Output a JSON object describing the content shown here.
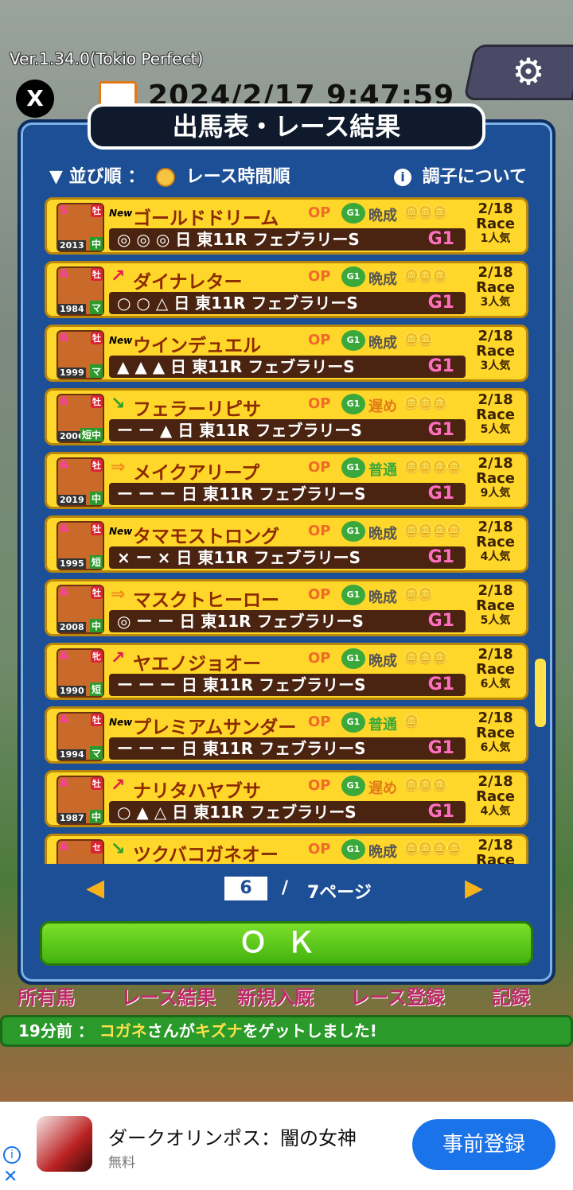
{
  "app": {
    "version": "Ver.1.34.0(Tokio Perfect)",
    "datetime": "2024/2/17 9:47:59",
    "x_label": "X"
  },
  "modal": {
    "title": "出馬表・レース結果",
    "sort_label": "▼ 並び順 ：",
    "sort_value": "レース時間順",
    "condition_label": "調子について",
    "info_glyph": "i"
  },
  "horses": [
    {
      "rank": "S",
      "sex": "牡",
      "year": "2013",
      "dist": "中",
      "badge": "New",
      "arrow": "",
      "arrow_color": "",
      "name": "ゴールドドリーム",
      "class": "OP",
      "growth": "晩成",
      "growth_type": "late-bloom",
      "coins": "🪙🪙🪙",
      "marks": "◎ ◎ ◎",
      "day": "日",
      "race": "東11R",
      "race_name": "フェブラリーS",
      "grade": "G1",
      "date": "2/18",
      "race_label": "Race",
      "popularity": "1人気"
    },
    {
      "rank": "A",
      "sex": "牡",
      "year": "1984",
      "dist": "マ",
      "badge": "",
      "arrow": "↗",
      "arrow_color": "#e0204a",
      "name": "ダイナレター",
      "class": "OP",
      "growth": "晩成",
      "growth_type": "late-bloom",
      "coins": "🪙🪙🪙",
      "marks": "○ ○ △",
      "day": "日",
      "race": "東11R",
      "race_name": "フェブラリーS",
      "grade": "G1",
      "date": "2/18",
      "race_label": "Race",
      "popularity": "3人気"
    },
    {
      "rank": "A",
      "sex": "牡",
      "year": "1999",
      "dist": "マ",
      "badge": "New",
      "arrow": "",
      "arrow_color": "",
      "name": "ウインデュエル",
      "class": "OP",
      "growth": "晩成",
      "growth_type": "late-bloom",
      "coins": "🪙🪙",
      "marks": "▲ ▲ ▲",
      "day": "日",
      "race": "東11R",
      "race_name": "フェブラリーS",
      "grade": "G1",
      "date": "2/18",
      "race_label": "Race",
      "popularity": "3人気"
    },
    {
      "rank": "A",
      "sex": "牡",
      "year": "2006",
      "dist": "短中",
      "badge": "",
      "arrow": "↘",
      "arrow_color": "#2aa02a",
      "name": "フェラーリピサ",
      "class": "OP",
      "growth": "遅め",
      "growth_type": "late",
      "coins": "🪙🪙🪙",
      "marks": "ー ー ▲",
      "day": "日",
      "race": "東11R",
      "race_name": "フェブラリーS",
      "grade": "G1",
      "date": "2/18",
      "race_label": "Race",
      "popularity": "5人気"
    },
    {
      "rank": "A",
      "sex": "牡",
      "year": "2019",
      "dist": "中",
      "badge": "",
      "arrow": "⇒",
      "arrow_color": "#f08a1a",
      "name": "メイクアリープ",
      "class": "OP",
      "growth": "普通",
      "growth_type": "normal",
      "coins": "🪙🪙🪙🪙",
      "marks": "ー ー ー",
      "day": "日",
      "race": "東11R",
      "race_name": "フェブラリーS",
      "grade": "G1",
      "date": "2/18",
      "race_label": "Race",
      "popularity": "9人気"
    },
    {
      "rank": "A",
      "sex": "牡",
      "year": "1995",
      "dist": "短",
      "badge": "New",
      "arrow": "",
      "arrow_color": "",
      "name": "タマモストロング",
      "class": "OP",
      "growth": "晩成",
      "growth_type": "late-bloom",
      "coins": "🪙🪙🪙🪙",
      "marks": "× ー ×",
      "day": "日",
      "race": "東11R",
      "race_name": "フェブラリーS",
      "grade": "G1",
      "date": "2/18",
      "race_label": "Race",
      "popularity": "4人気"
    },
    {
      "rank": "A",
      "sex": "牡",
      "year": "2008",
      "dist": "中",
      "badge": "",
      "arrow": "⇒",
      "arrow_color": "#f08a1a",
      "name": "マスクトヒーロー",
      "class": "OP",
      "growth": "晩成",
      "growth_type": "late-bloom",
      "coins": "🪙🪙",
      "marks": "◎ ー ー",
      "day": "日",
      "race": "東11R",
      "race_name": "フェブラリーS",
      "grade": "G1",
      "date": "2/18",
      "race_label": "Race",
      "popularity": "5人気"
    },
    {
      "rank": "A",
      "sex": "牝",
      "year": "1990",
      "dist": "短",
      "badge": "",
      "arrow": "↗",
      "arrow_color": "#e0204a",
      "name": "ヤエノジョオー",
      "class": "OP",
      "growth": "晩成",
      "growth_type": "late-bloom",
      "coins": "🪙🪙🪙",
      "marks": "ー ー ー",
      "day": "日",
      "race": "東11R",
      "race_name": "フェブラリーS",
      "grade": "G1",
      "date": "2/18",
      "race_label": "Race",
      "popularity": "6人気"
    },
    {
      "rank": "A",
      "sex": "牡",
      "year": "1994",
      "dist": "マ",
      "badge": "New",
      "arrow": "",
      "arrow_color": "",
      "name": "プレミアムサンダー",
      "class": "OP",
      "growth": "普通",
      "growth_type": "normal",
      "coins": "🪙",
      "marks": "ー ー ー",
      "day": "日",
      "race": "東11R",
      "race_name": "フェブラリーS",
      "grade": "G1",
      "date": "2/18",
      "race_label": "Race",
      "popularity": "6人気"
    },
    {
      "rank": "A",
      "sex": "牡",
      "year": "1987",
      "dist": "中",
      "badge": "",
      "arrow": "↗",
      "arrow_color": "#e0204a",
      "name": "ナリタハヤブサ",
      "class": "OP",
      "growth": "遅め",
      "growth_type": "late",
      "coins": "🪙🪙🪙",
      "marks": "○ ▲ △",
      "day": "日",
      "race": "東11R",
      "race_name": "フェブラリーS",
      "grade": "G1",
      "date": "2/18",
      "race_label": "Race",
      "popularity": "4人気"
    },
    {
      "rank": "A",
      "sex": "セ",
      "year": "",
      "dist": "",
      "badge": "",
      "arrow": "↘",
      "arrow_color": "#2aa02a",
      "name": "ツクバコガネオー",
      "class": "OP",
      "growth": "晩成",
      "growth_type": "late-bloom",
      "coins": "🪙🪙🪙🪙",
      "marks": "",
      "day": "",
      "race": "",
      "race_name": "",
      "grade": "",
      "date": "2/18",
      "race_label": "Race",
      "popularity": ""
    }
  ],
  "pager": {
    "current": "6",
    "separator": "/",
    "total": "7ページ",
    "prev_glyph": "◀",
    "next_glyph": "▶"
  },
  "ok_label": "ＯＫ",
  "menu_peek": [
    "所有馬",
    "レース結果",
    "新規入厩",
    "レース登録",
    "記録"
  ],
  "ticker": {
    "time": "19分前 ：",
    "user": "コガネ",
    "mid": "さんが",
    "item": "キズナ",
    "tail": "をゲットしました!"
  },
  "ad": {
    "title": "ダークオリンポス：闇の女神",
    "price": "無料",
    "button": "事前登録",
    "info_glyph": "i",
    "close_glyph": "✕"
  }
}
